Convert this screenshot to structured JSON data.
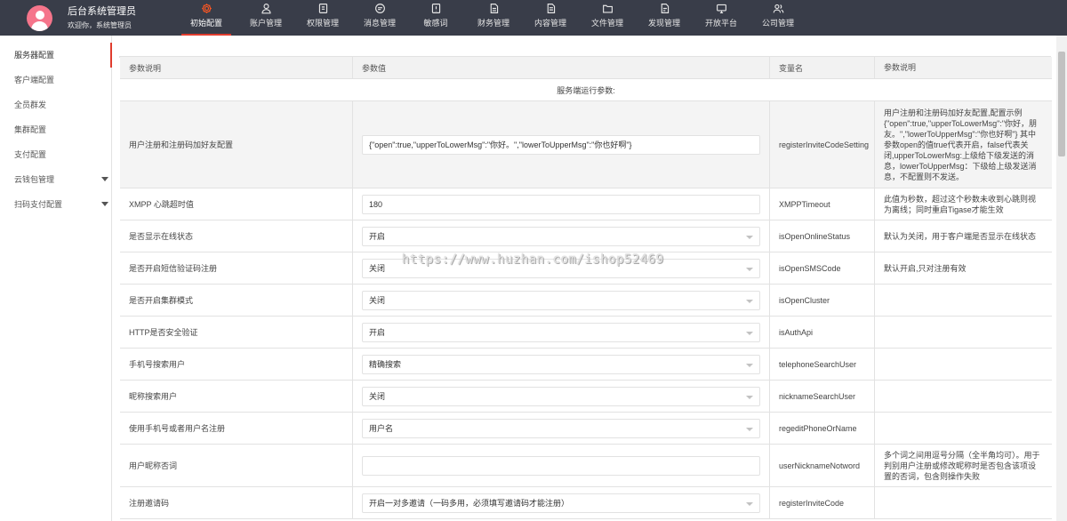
{
  "topbar": {
    "title": "后台系统管理员",
    "welcome": "欢迎你，系统管理员",
    "nav": [
      {
        "label": "初始配置",
        "icon": "gear-icon"
      },
      {
        "label": "账户管理",
        "icon": "user-icon"
      },
      {
        "label": "权限管理",
        "icon": "key-icon"
      },
      {
        "label": "消息管理",
        "icon": "message-icon"
      },
      {
        "label": "敏感词",
        "icon": "filter-icon"
      },
      {
        "label": "财务管理",
        "icon": "finance-icon"
      },
      {
        "label": "内容管理",
        "icon": "document-icon"
      },
      {
        "label": "文件管理",
        "icon": "folder-icon"
      },
      {
        "label": "发现管理",
        "icon": "discover-icon"
      },
      {
        "label": "开放平台",
        "icon": "monitor-icon"
      },
      {
        "label": "公司管理",
        "icon": "group-icon"
      }
    ]
  },
  "sidebar": {
    "items": [
      {
        "label": "服务器配置"
      },
      {
        "label": "客户端配置"
      },
      {
        "label": "全员群发"
      },
      {
        "label": "集群配置"
      },
      {
        "label": "支付配置"
      },
      {
        "label": "云钱包管理"
      },
      {
        "label": "扫码支付配置"
      }
    ]
  },
  "table": {
    "headers": [
      "参数说明",
      "参数值",
      "变量名",
      "参数说明"
    ],
    "section_title": "服务端运行参数:",
    "rows": [
      {
        "label": "用户注册和注册码加好友配置",
        "value": "{\"open\":true,\"upperToLowerMsg\":\"你好。\",\"lowerToUpperMsg\":\"你也好啊\"}",
        "var": "registerInviteCodeSetting",
        "desc": "用户注册和注册码加好友配置,配置示例{\"open\":true,\"upperToLowerMsg\":\"你好，朋友。\",\"lowerToUpperMsg\":\"你也好啊\"} 其中参数open的值true代表开启，false代表关闭,upperToLowerMsg:上级给下级发送的消息，lowerToUpperMsg：下级给上级发送消息，不配置则不发送。"
      },
      {
        "label": "XMPP 心跳超时值",
        "value": "180",
        "var": "XMPPTimeout",
        "desc": "此值为秒数，超过这个秒数未收到心跳则视为离线；同时重启Tigase才能生效"
      },
      {
        "label": "是否显示在线状态",
        "value": "开启",
        "var": "isOpenOnlineStatus",
        "desc": "默认为关闭，用于客户端是否显示在线状态"
      },
      {
        "label": "是否开启短信验证码注册",
        "value": "关闭",
        "var": "isOpenSMSCode",
        "desc": "默认开启,只对注册有效"
      },
      {
        "label": "是否开启集群模式",
        "value": "关闭",
        "var": "isOpenCluster",
        "desc": ""
      },
      {
        "label": "HTTP是否安全验证",
        "value": "开启",
        "var": "isAuthApi",
        "desc": ""
      },
      {
        "label": "手机号搜索用户",
        "value": "精确搜索",
        "var": "telephoneSearchUser",
        "desc": ""
      },
      {
        "label": "昵称搜索用户",
        "value": "关闭",
        "var": "nicknameSearchUser",
        "desc": ""
      },
      {
        "label": "使用手机号或者用户名注册",
        "value": "用户名",
        "var": "regeditPhoneOrName",
        "desc": ""
      },
      {
        "label": "用户昵称否词",
        "value": "",
        "var": "userNicknameNotword",
        "desc": "多个词之间用逗号分隔（全半角均可）。用于判别用户注册或修改昵称时是否包含该项设置的否词，包含则操作失败"
      },
      {
        "label": "注册邀请码",
        "value": "开启一对多邀请（一码多用，必须填写邀请码才能注册）",
        "var": "registerInviteCode",
        "desc": ""
      }
    ]
  },
  "watermark": "https://www.huzhan.com/ishop52469"
}
